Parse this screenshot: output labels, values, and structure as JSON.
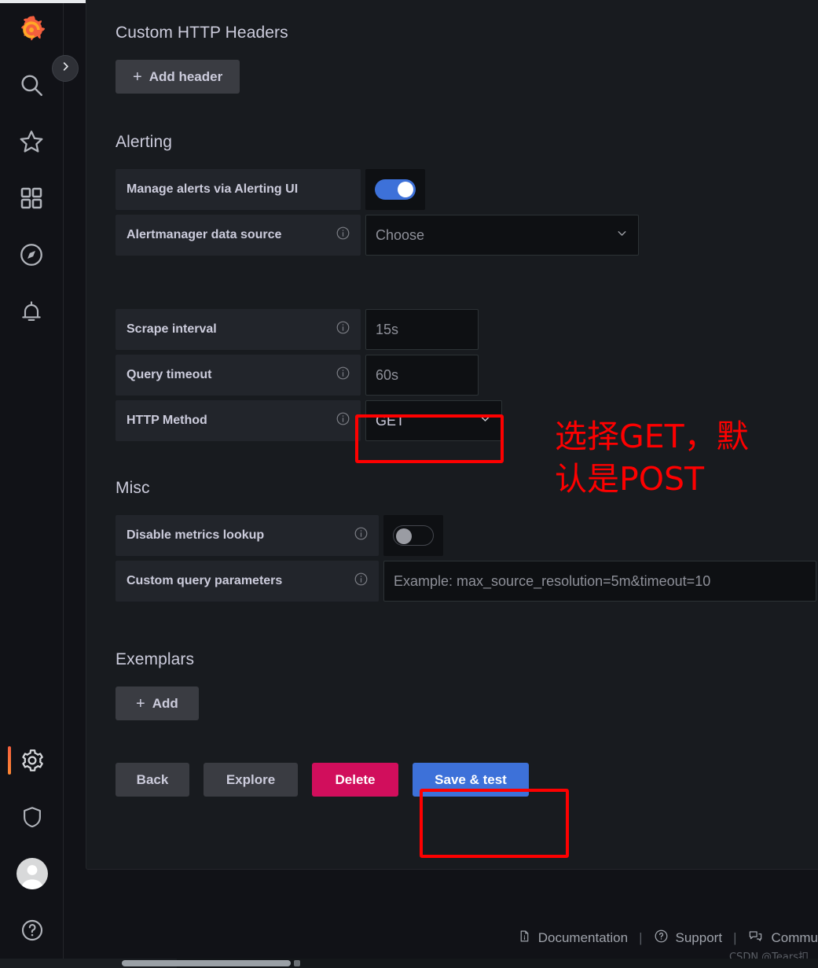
{
  "sidebar": {
    "logo_name": "grafana-logo",
    "expand_label": "Expand menu",
    "items": [
      {
        "name": "search",
        "icon": "search-icon"
      },
      {
        "name": "starred",
        "icon": "star-icon"
      },
      {
        "name": "dashboards",
        "icon": "dashboards-grid-icon"
      },
      {
        "name": "explore",
        "icon": "compass-icon"
      },
      {
        "name": "alerting",
        "icon": "bell-icon"
      }
    ],
    "bottom_items": [
      {
        "name": "configuration",
        "icon": "gear-icon",
        "active": true
      },
      {
        "name": "server-admin",
        "icon": "shield-icon",
        "active": false
      },
      {
        "name": "user-profile",
        "icon": "avatar-icon",
        "active": false
      },
      {
        "name": "help",
        "icon": "question-circle-icon",
        "active": false
      }
    ]
  },
  "headers_section": {
    "title": "Custom HTTP Headers",
    "add_header_label": "Add header",
    "plus": "+"
  },
  "alerting": {
    "title": "Alerting",
    "manage_alerts_label": "Manage alerts via Alerting UI",
    "manage_alerts_state": "on",
    "alertmanager_label": "Alertmanager data source",
    "alertmanager_value": "Choose"
  },
  "intervals": {
    "scrape_label": "Scrape interval",
    "scrape_value": "15s",
    "timeout_label": "Query timeout",
    "timeout_value": "60s",
    "http_method_label": "HTTP Method",
    "http_method_value": "GET"
  },
  "misc": {
    "title": "Misc",
    "disable_lookup_label": "Disable metrics lookup",
    "disable_lookup_state": "off",
    "custom_params_label": "Custom query parameters",
    "custom_params_placeholder": "Example: max_source_resolution=5m&timeout=10"
  },
  "exemplars": {
    "title": "Exemplars",
    "add_label": "Add",
    "plus": "+"
  },
  "actions": {
    "back_label": "Back",
    "explore_label": "Explore",
    "delete_label": "Delete",
    "save_test_label": "Save & test"
  },
  "annotation": {
    "text": "选择GET，默\n认是POST",
    "color": "#fe0000"
  },
  "footer": {
    "documentation_label": "Documentation",
    "support_label": "Support",
    "community_label": "Commu",
    "separator": "|",
    "watermark": "CSDN @Tears扣"
  },
  "colors": {
    "accent_blue": "#3d71d9",
    "danger_pink": "#d10e5c",
    "highlight_red": "#fe0000",
    "panel_bg": "#181b1f",
    "app_bg": "#111217"
  }
}
